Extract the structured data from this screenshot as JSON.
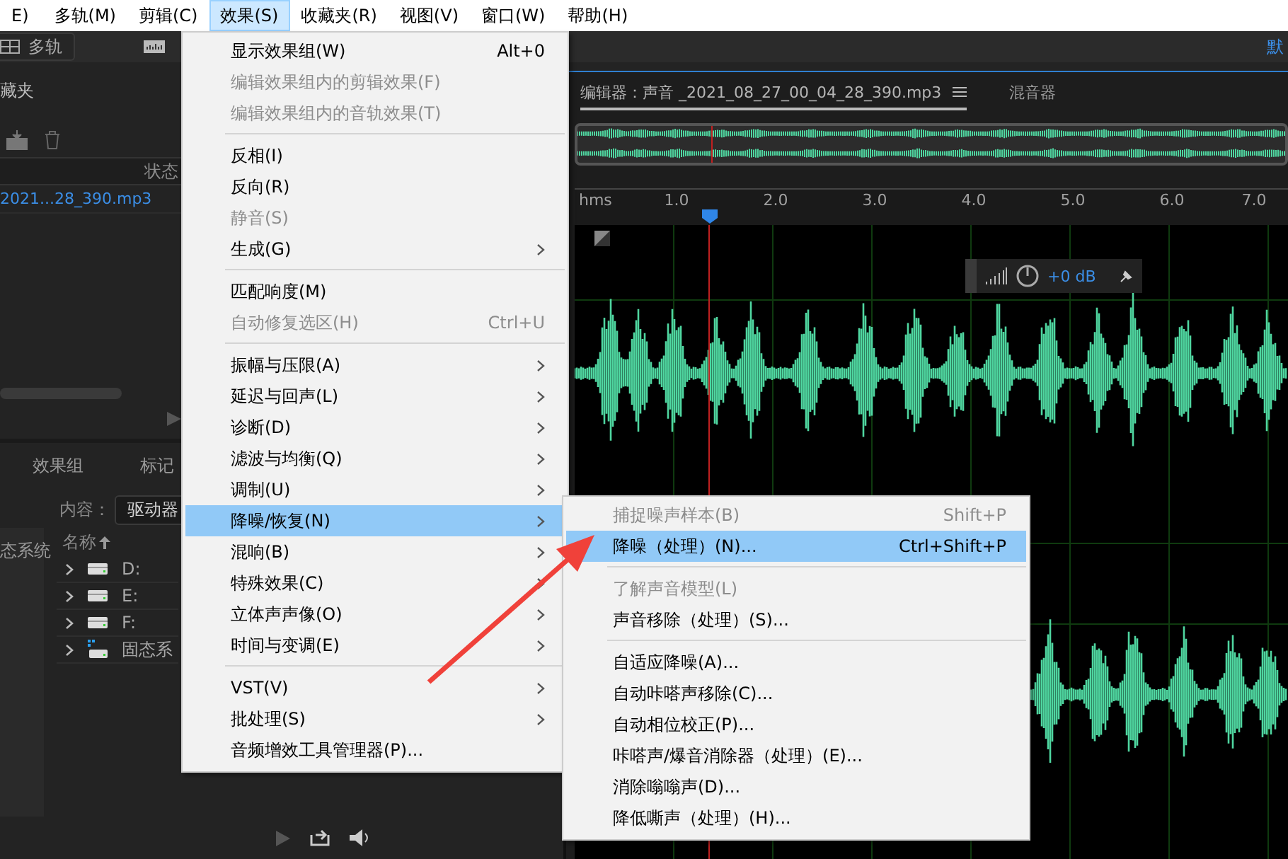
{
  "menubar": [
    {
      "label": "E)",
      "selected": false
    },
    {
      "label": "多轨(M)",
      "selected": false
    },
    {
      "label": "剪辑(C)",
      "selected": false
    },
    {
      "label": "效果(S)",
      "selected": true
    },
    {
      "label": "收藏夹(R)",
      "selected": false
    },
    {
      "label": "视图(V)",
      "selected": false
    },
    {
      "label": "窗口(W)",
      "selected": false
    },
    {
      "label": "帮助(H)",
      "selected": false
    }
  ],
  "toolbar": {
    "multitrack": "多轨",
    "workspace": "默"
  },
  "files_panel": {
    "title": "藏夹",
    "column": "状态",
    "files": [
      "2021...28_390.mp3"
    ]
  },
  "media_panel": {
    "tabs": [
      {
        "label": "效果组",
        "selected": false
      },
      {
        "label": "标记",
        "selected": false
      }
    ],
    "content_label": "内容：",
    "content_value": "驱动器",
    "side_item": "态系统",
    "column": "名称",
    "drives": [
      {
        "name": "D:",
        "kind": "drive"
      },
      {
        "name": "E:",
        "kind": "drive"
      },
      {
        "name": "F:",
        "kind": "drive"
      },
      {
        "name": "固态系",
        "kind": "system"
      }
    ]
  },
  "editor": {
    "tabs": [
      {
        "label": "编辑器：声音 _2021_08_27_00_04_28_390.mp3",
        "selected": true
      },
      {
        "label": "混音器",
        "selected": false
      }
    ],
    "ruler": [
      "hms",
      "1.0",
      "2.0",
      "3.0",
      "4.0",
      "5.0",
      "6.0",
      "7.0"
    ],
    "volume": "+0 dB"
  },
  "effects_menu": [
    {
      "kind": "item",
      "label": "显示效果组(W)",
      "shortcut": "Alt+0",
      "disabled": false,
      "submenu": false,
      "selected": false
    },
    {
      "kind": "item",
      "label": "编辑效果组内的剪辑效果(F)",
      "disabled": true,
      "submenu": false,
      "selected": false
    },
    {
      "kind": "item",
      "label": "编辑效果组内的音轨效果(T)",
      "disabled": true,
      "submenu": false,
      "selected": false
    },
    {
      "kind": "separator"
    },
    {
      "kind": "item",
      "label": "反相(I)",
      "disabled": false,
      "submenu": false,
      "selected": false
    },
    {
      "kind": "item",
      "label": "反向(R)",
      "disabled": false,
      "submenu": false,
      "selected": false
    },
    {
      "kind": "item",
      "label": "静音(S)",
      "disabled": true,
      "submenu": false,
      "selected": false
    },
    {
      "kind": "item",
      "label": "生成(G)",
      "disabled": false,
      "submenu": true,
      "selected": false
    },
    {
      "kind": "separator"
    },
    {
      "kind": "item",
      "label": "匹配响度(M)",
      "disabled": false,
      "submenu": false,
      "selected": false
    },
    {
      "kind": "item",
      "label": "自动修复选区(H)",
      "shortcut": "Ctrl+U",
      "disabled": true,
      "submenu": false,
      "selected": false
    },
    {
      "kind": "separator"
    },
    {
      "kind": "item",
      "label": "振幅与压限(A)",
      "disabled": false,
      "submenu": true,
      "selected": false
    },
    {
      "kind": "item",
      "label": "延迟与回声(L)",
      "disabled": false,
      "submenu": true,
      "selected": false
    },
    {
      "kind": "item",
      "label": "诊断(D)",
      "disabled": false,
      "submenu": true,
      "selected": false
    },
    {
      "kind": "item",
      "label": "滤波与均衡(Q)",
      "disabled": false,
      "submenu": true,
      "selected": false
    },
    {
      "kind": "item",
      "label": "调制(U)",
      "disabled": false,
      "submenu": true,
      "selected": false
    },
    {
      "kind": "item",
      "label": "降噪/恢复(N)",
      "disabled": false,
      "submenu": true,
      "selected": true
    },
    {
      "kind": "item",
      "label": "混响(B)",
      "disabled": false,
      "submenu": true,
      "selected": false
    },
    {
      "kind": "item",
      "label": "特殊效果(C)",
      "disabled": false,
      "submenu": true,
      "selected": false
    },
    {
      "kind": "item",
      "label": "立体声声像(O)",
      "disabled": false,
      "submenu": true,
      "selected": false
    },
    {
      "kind": "item",
      "label": "时间与变调(E)",
      "disabled": false,
      "submenu": true,
      "selected": false
    },
    {
      "kind": "separator"
    },
    {
      "kind": "item",
      "label": "VST(V)",
      "disabled": false,
      "submenu": true,
      "selected": false
    },
    {
      "kind": "item",
      "label": "批处理(S)",
      "disabled": false,
      "submenu": true,
      "selected": false
    },
    {
      "kind": "item",
      "label": "音频增效工具管理器(P)...",
      "disabled": false,
      "submenu": false,
      "selected": false
    }
  ],
  "submenu": [
    {
      "kind": "item",
      "label": "捕捉噪声样本(B)",
      "shortcut": "Shift+P",
      "disabled": true,
      "submenu": false,
      "selected": false
    },
    {
      "kind": "item",
      "label": "降噪（处理）(N)...",
      "shortcut": "Ctrl+Shift+P",
      "disabled": false,
      "submenu": false,
      "selected": true
    },
    {
      "kind": "separator"
    },
    {
      "kind": "item",
      "label": "了解声音模型(L)",
      "disabled": true,
      "submenu": false,
      "selected": false
    },
    {
      "kind": "item",
      "label": "声音移除（处理）(S)...",
      "disabled": false,
      "submenu": false,
      "selected": false
    },
    {
      "kind": "separator"
    },
    {
      "kind": "item",
      "label": "自适应降噪(A)...",
      "disabled": false,
      "submenu": false,
      "selected": false
    },
    {
      "kind": "item",
      "label": "自动咔嗒声移除(C)...",
      "disabled": false,
      "submenu": false,
      "selected": false
    },
    {
      "kind": "item",
      "label": "自动相位校正(P)...",
      "disabled": false,
      "submenu": false,
      "selected": false
    },
    {
      "kind": "item",
      "label": "咔嗒声/爆音消除器（处理）(E)...",
      "disabled": false,
      "submenu": false,
      "selected": false
    },
    {
      "kind": "item",
      "label": "消除嗡嗡声(D)...",
      "disabled": false,
      "submenu": false,
      "selected": false
    },
    {
      "kind": "item",
      "label": "降低嘶声（处理）(H)...",
      "disabled": false,
      "submenu": false,
      "selected": false
    }
  ],
  "annotation": {
    "arrow": true
  }
}
